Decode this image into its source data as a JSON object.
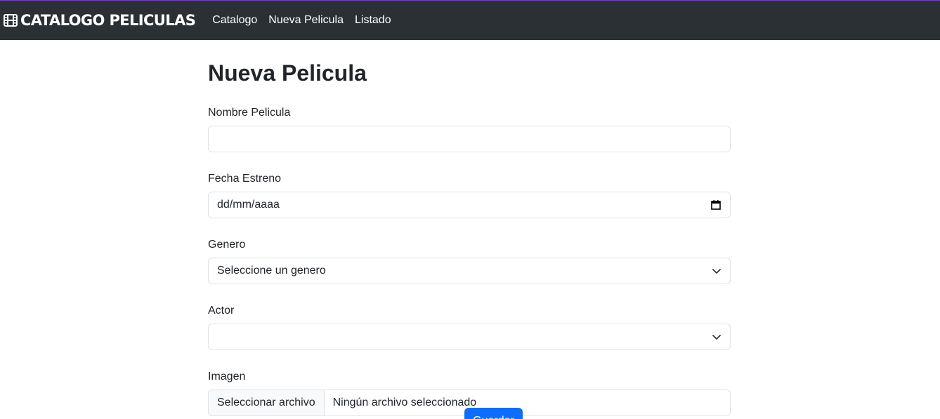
{
  "navbar": {
    "brand_text": "CATALOGO PELICULAS",
    "brand_icon": "film-icon",
    "links": [
      {
        "label": "Catalogo"
      },
      {
        "label": "Nueva Pelicula"
      },
      {
        "label": "Listado"
      }
    ],
    "colors": {
      "background": "#2b3035",
      "text": "#ffffff"
    }
  },
  "page": {
    "title": "Nueva Pelicula"
  },
  "form": {
    "nombre": {
      "label": "Nombre Pelicula",
      "value": ""
    },
    "fecha": {
      "label": "Fecha Estreno",
      "placeholder": "dd/mm/aaaa",
      "icon": "calendar-icon"
    },
    "genero": {
      "label": "Genero",
      "selected": "Seleccione un genero",
      "icon": "chevron-down-icon"
    },
    "actor": {
      "label": "Actor",
      "selected": "",
      "icon": "chevron-down-icon"
    },
    "imagen": {
      "label": "Imagen",
      "button_label": "Seleccionar archivo",
      "file_status": "Ningún archivo seleccionado"
    },
    "submit_label": "Guardar",
    "accent_color": "#0d6efd"
  }
}
